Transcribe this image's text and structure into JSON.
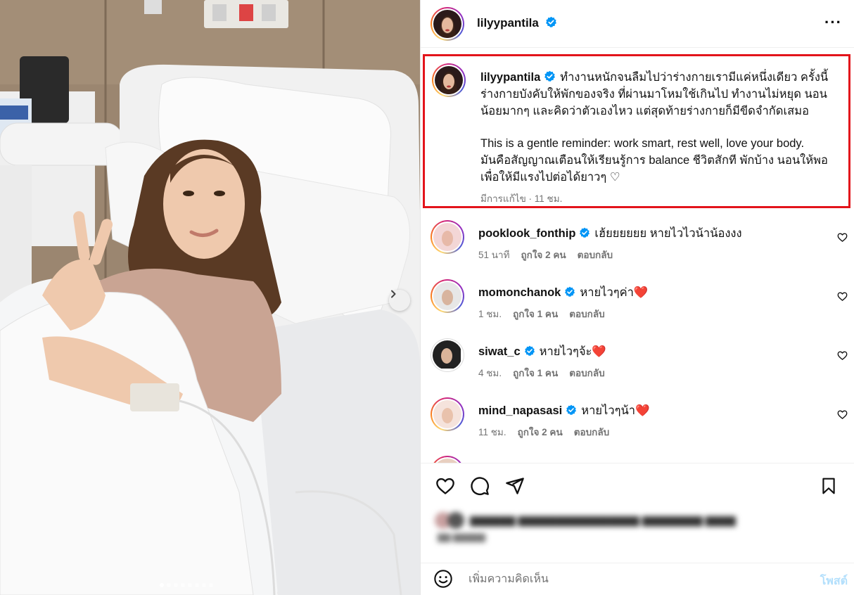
{
  "post": {
    "author": "lilyypantila",
    "more_label": "···"
  },
  "photo": {
    "slide_count": 8,
    "active_slide": 1
  },
  "caption": {
    "username": "lilyypantila",
    "text_th": "ทำงานหนักจนลืมไปว่าร่างกายเรามีแค่หนึ่งเดียว ครั้งนี้ร่างกายบังคับให้พักของจริง ที่ผ่านมาโหมใช้เกินไป ทำงานไม่หยุด นอนน้อยมากๆ และคิดว่าตัวเองไหว แต่สุดท้ายร่างกายก็มีขีดจำกัดเสมอ",
    "text_en": "This is a gentle reminder: work smart, rest well, love your body.",
    "text_th2": "มันคือสัญญาณเตือนให้เรียนรู้การ balance ชีวิตสักที พักบ้าง นอนให้พอ เพื่อให้มีแรงไปต่อได้ยาวๆ ♡",
    "meta": "มีการแก้ไข · 11 ชม."
  },
  "comments": [
    {
      "username": "pooklook_fonthip",
      "verified": true,
      "text": "เฮ้ยยยยยย หายไวไวน้าน้องงง",
      "time": "51 นาที",
      "likes": "ถูกใจ 2 คน",
      "reply": "ตอบกลับ"
    },
    {
      "username": "momonchanok",
      "verified": true,
      "text": "หายไวๆค่า❤️",
      "time": "1 ชม.",
      "likes": "ถูกใจ 1 คน",
      "reply": "ตอบกลับ"
    },
    {
      "username": "siwat_c",
      "verified": true,
      "text": "หายไวๆจ้ะ❤️",
      "time": "4 ชม.",
      "likes": "ถูกใจ 1 คน",
      "reply": "ตอบกลับ"
    },
    {
      "username": "mind_napasasi",
      "verified": true,
      "text": "หายไวๆน้า❤️",
      "time": "11 ชม.",
      "likes": "ถูกใจ 2 คน",
      "reply": "ตอบกลับ"
    }
  ],
  "actions": {
    "like_icon": "heart-outline-icon",
    "comment_icon": "comment-bubble-icon",
    "share_icon": "paper-plane-icon",
    "save_icon": "bookmark-icon"
  },
  "composer": {
    "placeholder": "เพิ่มความคิดเห็น",
    "post_label": "โพสต์"
  },
  "colors": {
    "verified": "#0095f6",
    "highlight_border": "#e3141b",
    "post_button": "#b2dffc",
    "heart_red": "#ff3040"
  }
}
